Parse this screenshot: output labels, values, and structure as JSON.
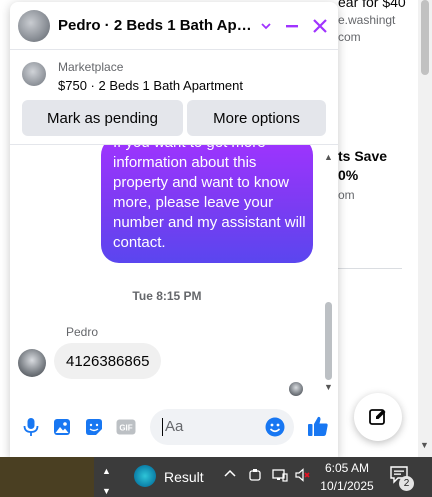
{
  "background_page": {
    "line1": "ear for $40",
    "line2": "e.washingt",
    "line3": "com",
    "line4": "ts Save",
    "line5": "0%",
    "line6": "om"
  },
  "chat": {
    "header": {
      "title": "Pedro · 2 Beds 1 Bath Apar...",
      "icons": [
        "chevron-down-icon",
        "minimize-icon",
        "close-icon"
      ],
      "accent_color": "#a033ff"
    },
    "listing": {
      "source": "Marketplace",
      "title": "$750 · 2 Beds 1 Bath Apartment"
    },
    "actions": {
      "mark_pending": "Mark as pending",
      "more_options": "More options"
    },
    "messages": {
      "outgoing_text": "If you want to get more information about this property and want to know more, please leave your number and my assistant will contact.",
      "timestamp": "Tue 8:15 PM",
      "sender": "Pedro",
      "incoming_text": "4126386865"
    },
    "composer": {
      "placeholder": "Aa",
      "icons": [
        "microphone-icon",
        "photo-icon",
        "sticker-icon",
        "gif-icon",
        "emoji-icon",
        "thumbs-up-icon"
      ],
      "gif_label": "GIF"
    }
  },
  "taskbar": {
    "app_label": "Result",
    "time": "6:05 AM",
    "date": "10/1/2025",
    "notification_count": "2"
  }
}
